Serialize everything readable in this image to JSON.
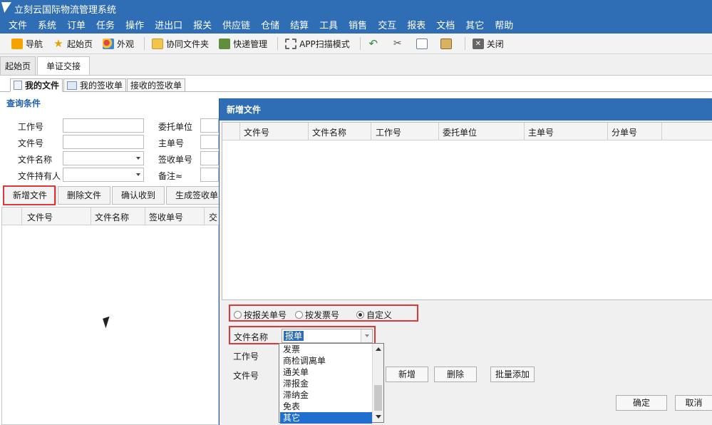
{
  "app": {
    "title": "立刻云国际物流管理系统"
  },
  "menu": [
    "文件",
    "系统",
    "订单",
    "任务",
    "操作",
    "进出口",
    "报关",
    "供应链",
    "仓储",
    "结算",
    "工具",
    "销售",
    "交互",
    "报表",
    "文档",
    "其它",
    "帮助"
  ],
  "toolbar": {
    "nav": "导航",
    "home": "起始页",
    "appearance": "外观",
    "shared_folder": "协同文件夹",
    "courier": "快递管理",
    "scan_mode": "APP扫描模式",
    "close": "关闭"
  },
  "page_tabs": [
    "起始页",
    "单证交接"
  ],
  "sub_tabs": [
    "我的文件",
    "我的签收单",
    "接收的签收单"
  ],
  "query": {
    "title": "查询条件",
    "labels": {
      "work_no": "工作号",
      "file_no": "文件号",
      "file_name": "文件名称",
      "holder": "文件持有人",
      "client": "委托单位",
      "master_no": "主单号",
      "receipt_no": "签收单号",
      "remark": "备注≈"
    }
  },
  "actions": [
    "新增文件",
    "删除文件",
    "确认收到",
    "生成签收单"
  ],
  "left_grid": {
    "columns": [
      "文件号",
      "文件名称",
      "签收单号",
      "交"
    ]
  },
  "dialog": {
    "title": "新增文件",
    "columns": [
      "文件号",
      "文件名称",
      "工作号",
      "委托单位",
      "主单号",
      "分单号"
    ],
    "radios": [
      {
        "label": "按报关单号",
        "checked": false
      },
      {
        "label": "按发票号",
        "checked": false
      },
      {
        "label": "自定义",
        "checked": true
      }
    ],
    "file_name_label": "文件名称",
    "file_name_value": "报单",
    "work_no_label": "工作号",
    "file_no_label": "文件号",
    "dropdown": {
      "options": [
        "发票",
        "商检调离单",
        "通关单",
        "滞报金",
        "滞纳金",
        "免表",
        "其它"
      ],
      "selected": "其它"
    },
    "buttons": {
      "add": "新增",
      "delete": "删除",
      "batch_add": "批量添加",
      "ok": "确定",
      "cancel": "取消"
    }
  }
}
